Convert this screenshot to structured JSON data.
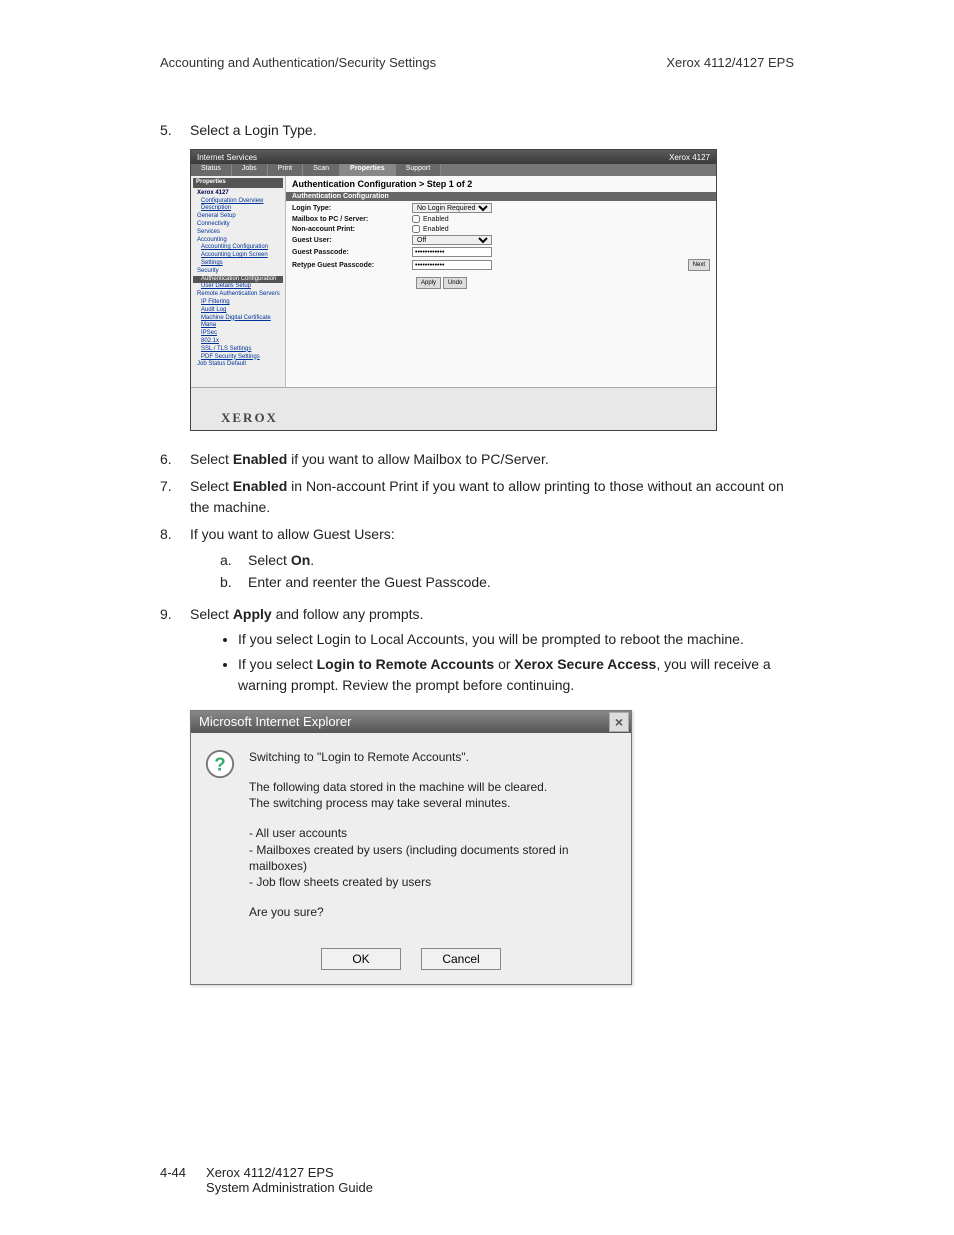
{
  "header": {
    "left": "Accounting and Authentication/Security Settings",
    "right": "Xerox 4112/4127 EPS"
  },
  "steps": {
    "s5_num": "5.",
    "s5_text": "Select a Login Type.",
    "s6_num": "6.",
    "s6_pre": "Select ",
    "s6_bold": "Enabled",
    "s6_post": " if you want to allow Mailbox to PC/Server.",
    "s7_num": "7.",
    "s7_pre": "Select ",
    "s7_bold": "Enabled",
    "s7_post": " in Non-account Print if you want to allow printing to those without an account on the machine.",
    "s8_num": "8.",
    "s8_text": "If you want to allow Guest Users:",
    "s8a_num": "a.",
    "s8a_pre": "Select ",
    "s8a_bold": "On",
    "s8a_post": ".",
    "s8b_num": "b.",
    "s8b_text": "Enter and reenter the Guest Passcode.",
    "s9_num": "9.",
    "s9_pre": "Select ",
    "s9_bold": "Apply",
    "s9_post": " and follow any prompts.",
    "s9_b1": "If you select Login to Local Accounts, you will be prompted to reboot the machine.",
    "s9_b2_pre": "If you select ",
    "s9_b2_bold1": "Login to Remote Accounts",
    "s9_b2_mid": " or ",
    "s9_b2_bold2": "Xerox Secure Access",
    "s9_b2_post": ", you will receive a warning prompt. Review the prompt before continuing."
  },
  "shot1": {
    "title_left": "Internet Services",
    "title_right": "Xerox 4127",
    "tabs": {
      "status": "Status",
      "jobs": "Jobs",
      "print": "Print",
      "scan": "Scan",
      "properties": "Properties",
      "support": "Support"
    },
    "sidebar": {
      "hdr": "Properties",
      "device": "Xerox 4127",
      "items": [
        "Configuration Overview",
        "Description",
        "General Setup",
        "Connectivity",
        "Services",
        "Accounting",
        "Accounting Configuration",
        "Accounting Login Screen Settings",
        "Security",
        "Authentication Configuration",
        "User Details Setup",
        "Remote Authentication Servers",
        "IP Filtering",
        "Audit Log",
        "Machine Digital Certificate Mana",
        "IPSec",
        "802.1x",
        "SSL / TLS Settings",
        "PDF Security Settings",
        "Job Status Default"
      ]
    },
    "breadcrumb": "Authentication Configuration > Step 1 of 2",
    "section": "Authentication Configuration",
    "fields": {
      "login_type_lbl": "Login Type:",
      "login_type_val": "No Login Required",
      "mailbox_lbl": "Mailbox to PC / Server:",
      "mailbox_val": "Enabled",
      "nonacct_lbl": "Non-account Print:",
      "nonacct_val": "Enabled",
      "guest_user_lbl": "Guest User:",
      "guest_user_val": "Off",
      "guest_pass_lbl": "Guest Passcode:",
      "guest_pass_val": "••••••••••••",
      "retype_lbl": "Retype Guest Passcode:",
      "retype_val": "••••••••••••"
    },
    "apply_btn": "Apply",
    "undo_btn": "Undo",
    "next_btn": "Next",
    "logo": "XEROX"
  },
  "dialog": {
    "title": "Microsoft Internet Explorer",
    "line1": "Switching to \"Login to Remote Accounts\".",
    "line2": "The following data stored in the machine will be cleared.\nThe switching process may take several minutes.",
    "line3": "- All user accounts\n- Mailboxes created by users (including documents stored in mailboxes)\n- Job flow sheets created by users",
    "line4": "Are you sure?",
    "ok": "OK",
    "cancel": "Cancel"
  },
  "footer": {
    "page_num": "4-44",
    "line1": "Xerox 4112/4127 EPS",
    "line2": "System Administration Guide"
  }
}
